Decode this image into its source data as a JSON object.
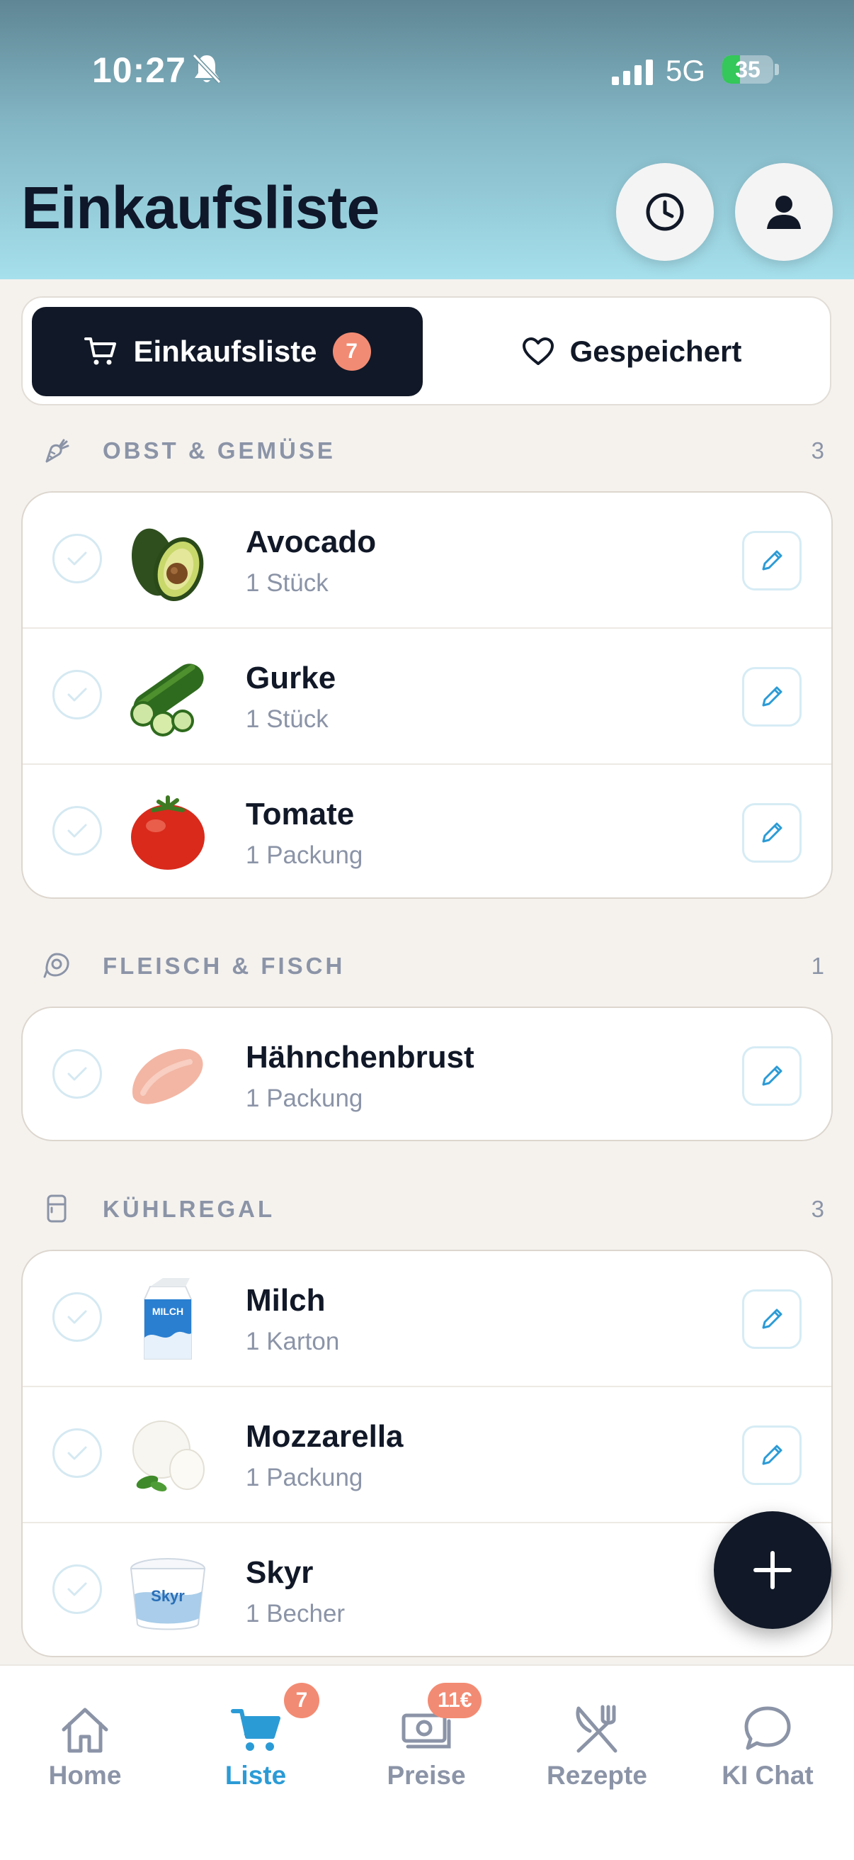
{
  "status_bar": {
    "time": "10:27",
    "network": "5G",
    "battery": "35"
  },
  "header": {
    "title": "Einkaufsliste"
  },
  "tabs": [
    {
      "label": "Einkaufsliste",
      "badge": "7"
    },
    {
      "label": "Gespeichert"
    }
  ],
  "sections": [
    {
      "title": "OBST & GEMÜSE",
      "count": "3",
      "icon": "carrot-icon",
      "items": [
        {
          "name": "Avocado",
          "qty": "1 Stück",
          "image": "avocado"
        },
        {
          "name": "Gurke",
          "qty": "1 Stück",
          "image": "cucumber"
        },
        {
          "name": "Tomate",
          "qty": "1 Packung",
          "image": "tomato"
        }
      ]
    },
    {
      "title": "FLEISCH & FISCH",
      "count": "1",
      "icon": "meat-icon",
      "items": [
        {
          "name": "Hähnchenbrust",
          "qty": "1 Packung",
          "image": "chicken-breast"
        }
      ]
    },
    {
      "title": "KÜHLREGAL",
      "count": "3",
      "icon": "fridge-icon",
      "items": [
        {
          "name": "Milch",
          "qty": "1 Karton",
          "image": "milk-carton",
          "image_text": "MILCH"
        },
        {
          "name": "Mozzarella",
          "qty": "1 Packung",
          "image": "mozzarella"
        },
        {
          "name": "Skyr",
          "qty": "1 Becher",
          "image": "skyr-cup",
          "image_text": "Skyr"
        }
      ]
    }
  ],
  "nav": [
    {
      "label": "Home",
      "icon": "home-icon"
    },
    {
      "label": "Liste",
      "icon": "cart-icon",
      "badge": "7",
      "active": true
    },
    {
      "label": "Preise",
      "icon": "money-icon",
      "badge": "11€"
    },
    {
      "label": "Rezepte",
      "icon": "utensils-icon"
    },
    {
      "label": "KI Chat",
      "icon": "chat-icon"
    }
  ],
  "colors": {
    "accent": "#2b9bd6",
    "dark": "#111827",
    "badge": "#f28b73",
    "muted": "#8b94a7"
  }
}
